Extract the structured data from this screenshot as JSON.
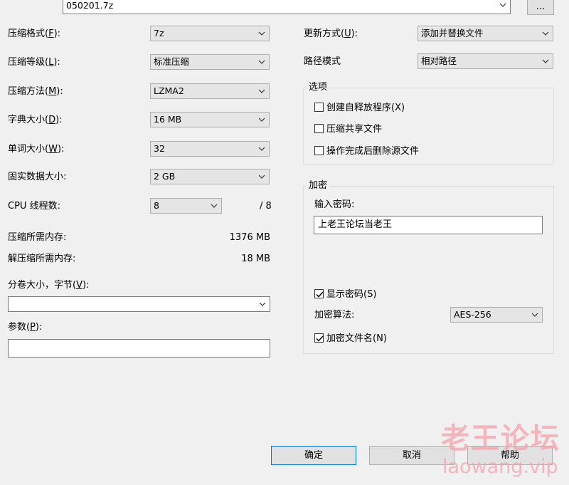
{
  "archive": {
    "filename": "050201.7z",
    "browse_label": "..."
  },
  "left": {
    "format": {
      "label": "压缩格式(F):",
      "value": "7z"
    },
    "level": {
      "label": "压缩等级(L):",
      "value": "标准压缩"
    },
    "method": {
      "label": "压缩方法(M):",
      "value": "LZMA2"
    },
    "dict": {
      "label": "字典大小(D):",
      "value": "16 MB"
    },
    "word": {
      "label": "单词大小(W):",
      "value": "32"
    },
    "solid": {
      "label": "固实数据大小:",
      "value": "2 GB"
    },
    "threads": {
      "label": "CPU 线程数:",
      "value": "8",
      "max": "/ 8"
    },
    "mem_compress": {
      "label": "压缩所需内存:",
      "value": "1376 MB"
    },
    "mem_decompress": {
      "label": "解压缩所需内存:",
      "value": "18 MB"
    },
    "volume": {
      "label": "分卷大小，字节(V):",
      "value": ""
    },
    "params": {
      "label": "参数(P):",
      "value": ""
    }
  },
  "right": {
    "update": {
      "label": "更新方式(U):",
      "value": "添加并替换文件"
    },
    "path": {
      "label": "路径模式",
      "value": "相对路径"
    },
    "options": {
      "title": "选项",
      "sfx": "创建自释放程序(X)",
      "shared": "压缩共享文件",
      "delete": "操作完成后删除源文件"
    },
    "encryption": {
      "title": "加密",
      "password_label": "输入密码:",
      "password_value": "上老王论坛当老王",
      "show_password": "显示密码(S)",
      "method_label": "加密算法:",
      "method_value": "AES-256",
      "encrypt_names": "加密文件名(N)"
    }
  },
  "buttons": {
    "ok": "确定",
    "cancel": "取消",
    "help": "帮助"
  },
  "watermark": {
    "line1": "老王论坛",
    "line2": "laowang.vip"
  }
}
